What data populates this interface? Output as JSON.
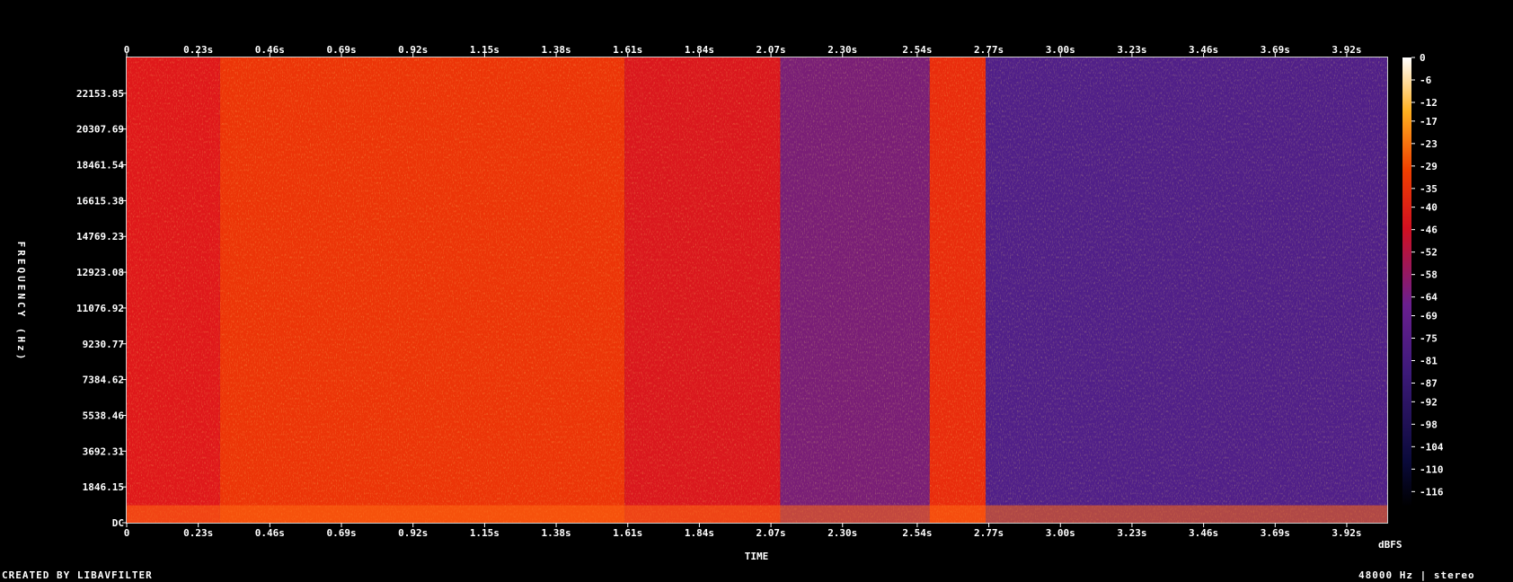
{
  "chart_data": {
    "type": "heatmap",
    "title": "",
    "xlabel": "TIME",
    "ylabel": "FREQUENCY (Hz)",
    "colorbar_label": "dBFS",
    "x_ticks_top": [
      "0",
      "0.23s",
      "0.46s",
      "0.69s",
      "0.92s",
      "1.15s",
      "1.38s",
      "1.61s",
      "1.84s",
      "2.07s",
      "2.30s",
      "2.54s",
      "2.77s",
      "3.00s",
      "3.23s",
      "3.46s",
      "3.69s",
      "3.92s"
    ],
    "x_ticks_bottom": [
      "0",
      "0.23s",
      "0.46s",
      "0.69s",
      "0.92s",
      "1.15s",
      "1.38s",
      "1.61s",
      "1.84s",
      "2.07s",
      "2.30s",
      "2.54s",
      "2.77s",
      "3.00s",
      "3.23s",
      "3.46s",
      "3.69s",
      "3.92s"
    ],
    "x_tick_values": [
      0,
      0.23,
      0.46,
      0.69,
      0.92,
      1.15,
      1.38,
      1.61,
      1.84,
      2.07,
      2.3,
      2.54,
      2.77,
      3.0,
      3.23,
      3.46,
      3.69,
      3.92
    ],
    "xlim": [
      0,
      4.05
    ],
    "y_ticks": [
      "DC",
      "1846.15",
      "3692.31",
      "5538.46",
      "7384.62",
      "9230.77",
      "11076.92",
      "12923.08",
      "14769.23",
      "16615.38",
      "18461.54",
      "20307.69",
      "22153.85"
    ],
    "y_tick_values": [
      0,
      1846.15,
      3692.31,
      5538.46,
      7384.62,
      9230.77,
      11076.92,
      12923.08,
      14769.23,
      16615.38,
      18461.54,
      20307.69,
      22153.85
    ],
    "ylim": [
      0,
      24000
    ],
    "colorbar_ticks": [
      "0",
      "-6",
      "-12",
      "-17",
      "-23",
      "-29",
      "-35",
      "-40",
      "-46",
      "-52",
      "-58",
      "-64",
      "-69",
      "-75",
      "-81",
      "-87",
      "-92",
      "-98",
      "-104",
      "-110",
      "-116"
    ],
    "colorbar_range": [
      -120,
      0
    ],
    "time_segments": [
      {
        "t0": 0.0,
        "t1": 0.3,
        "db": -56
      },
      {
        "t0": 0.3,
        "t1": 1.6,
        "db": -48
      },
      {
        "t0": 1.6,
        "t1": 2.1,
        "db": -58
      },
      {
        "t0": 2.1,
        "t1": 2.58,
        "db": -76
      },
      {
        "t0": 2.58,
        "t1": 2.76,
        "db": -50
      },
      {
        "t0": 2.76,
        "t1": 4.05,
        "db": -84
      }
    ],
    "colors": {
      "low": "#0a0a3a",
      "mid": "#5a1f8f",
      "high": "#e01818",
      "peak": "#ffd23a",
      "white": "#ffffff"
    }
  },
  "footer": {
    "left": "CREATED BY LIBAVFILTER",
    "right": "48000 Hz | stereo"
  }
}
